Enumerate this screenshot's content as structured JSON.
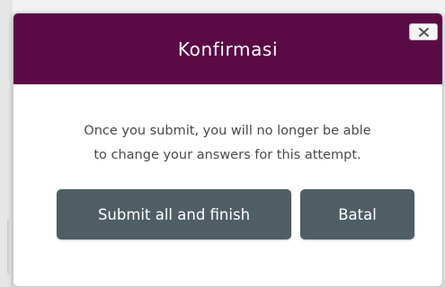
{
  "dialog": {
    "title": "Konfirmasi",
    "message_line1": "Once you submit, you will no longer be able",
    "message_line2": "to change your answers for this attempt.",
    "close_icon": "close-icon",
    "submit_label": "Submit all and finish",
    "cancel_label": "Batal"
  },
  "colors": {
    "header": "#5a0a45",
    "button": "#4f5e65",
    "title_text": "#ffffff",
    "body_text": "#4a4a4a"
  }
}
